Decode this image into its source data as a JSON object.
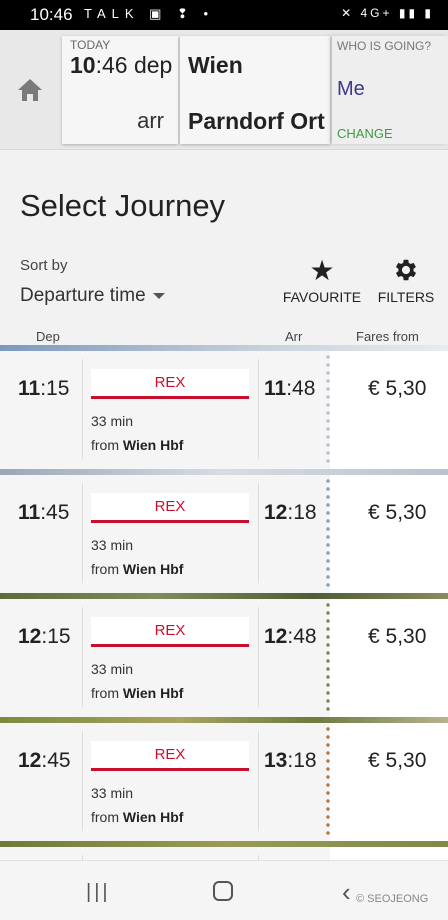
{
  "status_bar": {
    "time": "10:46",
    "left_icons": "TALK ▣ ❢ •",
    "right_icons": "✕ 4G+ ▮▮ ▮"
  },
  "header": {
    "today_label": "TODAY",
    "dep_time_hour": "10",
    "dep_time_rest": ":46",
    "dep_label": "dep",
    "arr_label": "arr",
    "from": "Wien",
    "to": "Parndorf Ort",
    "who_label": "WHO IS GOING?",
    "who_value": "Me",
    "change_label": "CHANGE"
  },
  "page_title": "Select Journey",
  "sort": {
    "label": "Sort by",
    "value": "Departure time"
  },
  "actions": {
    "favourite": "FAVOURITE",
    "filters": "FILTERS"
  },
  "columns": {
    "dep": "Dep",
    "arr": "Arr",
    "fares": "Fares from"
  },
  "journeys": [
    {
      "dep_h": "11",
      "dep_m": ":15",
      "arr_h": "11",
      "arr_m": ":48",
      "train": "REX",
      "duration": "33 min",
      "from_prefix": "from",
      "from": "Wien Hbf",
      "fare": "€ 5,30",
      "band": "#9aa9bd"
    },
    {
      "dep_h": "11",
      "dep_m": ":45",
      "arr_h": "12",
      "arr_m": ":18",
      "train": "REX",
      "duration": "33 min",
      "from_prefix": "from",
      "from": "Wien Hbf",
      "fare": "€ 5,30",
      "band": "#aab6c4"
    },
    {
      "dep_h": "12",
      "dep_m": ":15",
      "arr_h": "12",
      "arr_m": ":48",
      "train": "REX",
      "duration": "33 min",
      "from_prefix": "from",
      "from": "Wien Hbf",
      "fare": "€ 5,30",
      "band": "#6b7a4a"
    },
    {
      "dep_h": "12",
      "dep_m": ":45",
      "arr_h": "13",
      "arr_m": ":18",
      "train": "REX",
      "duration": "33 min",
      "from_prefix": "from",
      "from": "Wien Hbf",
      "fare": "€ 5,30",
      "band": "#8c8a4c"
    }
  ],
  "watermark": "© SEOJEONG",
  "colors": {
    "accent_red": "#c8102e",
    "change_green": "#3f9a3f",
    "me_blue": "#3a3a8a"
  }
}
